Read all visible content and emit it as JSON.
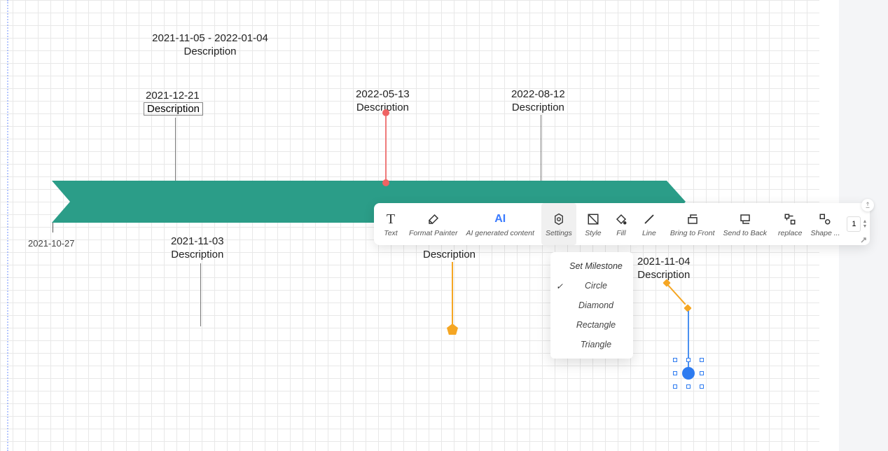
{
  "timeline": {
    "start_label": "2021-10-27",
    "band_color": "#2b9d88",
    "range_event": {
      "date_range": "2021-11-05 - 2022-01-04",
      "desc": "Description"
    },
    "milestones_top": [
      {
        "date": "2021-12-21",
        "desc": "Description",
        "boxed": true
      },
      {
        "date": "2022-05-13",
        "desc": "Description",
        "style": "red"
      },
      {
        "date": "2022-08-12",
        "desc": "Description",
        "style": "plain"
      }
    ],
    "milestones_bottom": [
      {
        "date": "2021-11-03",
        "desc": "Description",
        "style": "line"
      },
      {
        "label_only": "Description",
        "style": "orange-pentagon"
      },
      {
        "date": "2021-11-04",
        "desc": "Description",
        "style": "blue-selected"
      }
    ]
  },
  "toolbar": {
    "items": [
      {
        "id": "text",
        "label": "Text",
        "icon": "T"
      },
      {
        "id": "format-painter",
        "label": "Format Painter",
        "icon": "paint"
      },
      {
        "id": "ai",
        "label": "AI generated content",
        "icon": "AI"
      },
      {
        "id": "settings",
        "label": "Settings",
        "icon": "gear",
        "selected": true
      },
      {
        "id": "style",
        "label": "Style",
        "icon": "style"
      },
      {
        "id": "fill",
        "label": "Fill",
        "icon": "fill"
      },
      {
        "id": "line",
        "label": "Line",
        "icon": "line"
      },
      {
        "id": "bring-front",
        "label": "Bring to Front",
        "icon": "front"
      },
      {
        "id": "send-back",
        "label": "Send to Back",
        "icon": "back"
      },
      {
        "id": "replace",
        "label": "replace",
        "icon": "replace"
      },
      {
        "id": "shape",
        "label": "Shape ...",
        "icon": "shape"
      }
    ],
    "number_value": "1"
  },
  "dropdown": {
    "header": "Set Milestone",
    "items": [
      {
        "label": "Circle",
        "checked": true
      },
      {
        "label": "Diamond",
        "checked": false
      },
      {
        "label": "Rectangle",
        "checked": false
      },
      {
        "label": "Triangle",
        "checked": false
      }
    ]
  }
}
